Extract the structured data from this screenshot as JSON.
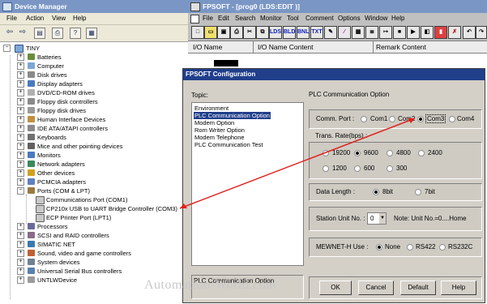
{
  "device_manager": {
    "title": "Device Manager",
    "menu": [
      "File",
      "Action",
      "View",
      "Help"
    ],
    "root": "TINY",
    "items": [
      {
        "label": "Batteries",
        "expanded": false
      },
      {
        "label": "Computer",
        "expanded": false
      },
      {
        "label": "Disk drives",
        "expanded": false
      },
      {
        "label": "Display adapters",
        "expanded": false
      },
      {
        "label": "DVD/CD-ROM drives",
        "expanded": false
      },
      {
        "label": "Floppy disk controllers",
        "expanded": false
      },
      {
        "label": "Floppy disk drives",
        "expanded": false
      },
      {
        "label": "Human Interface Devices",
        "expanded": false
      },
      {
        "label": "IDE ATA/ATAPI controllers",
        "expanded": false
      },
      {
        "label": "Keyboards",
        "expanded": false
      },
      {
        "label": "Mice and other pointing devices",
        "expanded": false
      },
      {
        "label": "Monitors",
        "expanded": false
      },
      {
        "label": "Network adapters",
        "expanded": false
      },
      {
        "label": "Other devices",
        "expanded": false
      },
      {
        "label": "PCMCIA adapters",
        "expanded": false
      },
      {
        "label": "Ports (COM & LPT)",
        "expanded": true
      },
      {
        "label": "Processors",
        "expanded": false
      },
      {
        "label": "SCSI and RAID controllers",
        "expanded": false
      },
      {
        "label": "SIMATIC NET",
        "expanded": false
      },
      {
        "label": "Sound, video and game controllers",
        "expanded": false
      },
      {
        "label": "System devices",
        "expanded": false
      },
      {
        "label": "Universal Serial Bus controllers",
        "expanded": false
      },
      {
        "label": "UNTLWDevice",
        "expanded": false
      }
    ],
    "ports_children": [
      "Communications Port (COM1)",
      "CP210x USB to UART Bridge Controller (COM3)",
      "ECP Printer Port (LPT1)"
    ]
  },
  "fpsoft": {
    "title": "FPSOFT - [prog0    (LDS:EDIT )]",
    "menu": [
      "File",
      "Edit",
      "Search",
      "Monitor",
      "Tool",
      "Comment",
      "Options",
      "Window",
      "Help"
    ],
    "toolbar_labels": [
      "LDS",
      "BLD",
      "BNL",
      "TXT"
    ],
    "columns": [
      "I/O Name",
      "I/O Name Content",
      "Remark Content"
    ]
  },
  "dialog": {
    "title": "FPSOFT Configuration",
    "topic_label": "Topic:",
    "topics": [
      "Environment",
      "PLC Communication Option",
      "Modem Option",
      "Rom Writer Option",
      "Modem Telephone",
      "PLC Communication Test"
    ],
    "selected_topic_index": 1,
    "section_title": "PLC Communication Option",
    "comm_port": {
      "label": "Comm. Port :",
      "options": [
        "Com1",
        "Com2",
        "Com3",
        "Com4"
      ],
      "selected": "Com3"
    },
    "trans_rate": {
      "label": "Trans. Rate(bps) :",
      "options": [
        "19200",
        "9600",
        "4800",
        "2400",
        "1200",
        "600",
        "300"
      ],
      "selected": "9600"
    },
    "data_length": {
      "label": "Data Length :",
      "options": [
        "8bit",
        "7bit"
      ],
      "selected": "8bit"
    },
    "station": {
      "label": "Station Unit No. :",
      "value": "0",
      "note": "Note: Unit No.=0....Home"
    },
    "mewnet": {
      "label": "MEWNET-H Use :",
      "options": [
        "None",
        "RS422",
        "RS232C"
      ],
      "selected": "None"
    },
    "status_text": "PLC Communication Option",
    "buttons": {
      "ok": "OK",
      "cancel": "Cancel",
      "default": "Default",
      "help": "Help"
    }
  },
  "watermark": "Automation-World.com",
  "colors": {
    "title_active": "#203e8a",
    "title_inactive": "#7a96c4",
    "arrow": "#e0201c",
    "selection": "#203e8a"
  }
}
